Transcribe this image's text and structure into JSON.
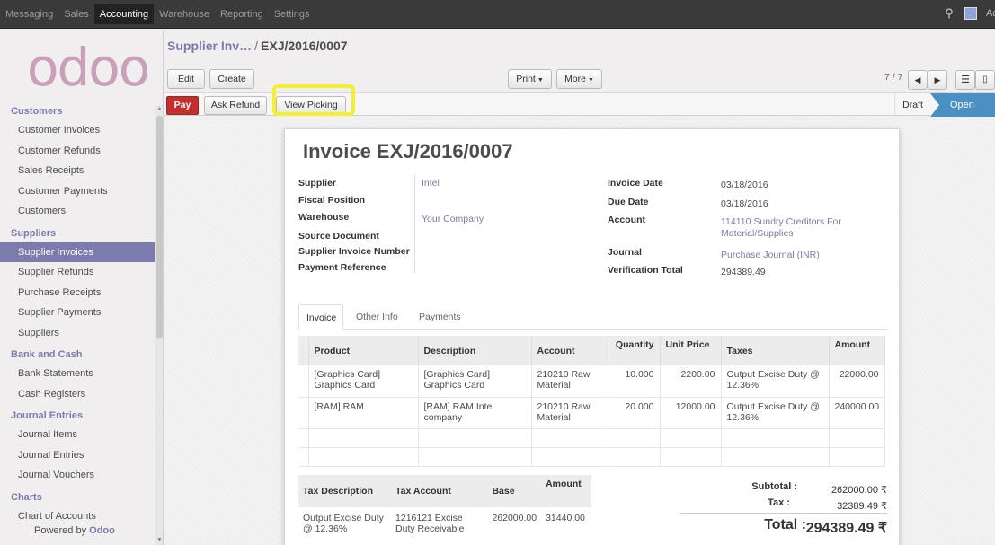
{
  "topbar": {
    "menu": [
      "Messaging",
      "Sales",
      "Accounting",
      "Warehouse",
      "Reporting",
      "Settings"
    ],
    "active": "Accounting",
    "user_text": "Ad"
  },
  "sidebar": {
    "logo": "odoo",
    "sections": [
      {
        "title": "Customers",
        "items": [
          "Customer Invoices",
          "Customer Refunds",
          "Sales Receipts",
          "Customer Payments",
          "Customers"
        ]
      },
      {
        "title": "Suppliers",
        "items": [
          "Supplier Invoices",
          "Supplier Refunds",
          "Purchase Receipts",
          "Supplier Payments",
          "Suppliers"
        ]
      },
      {
        "title": "Bank and Cash",
        "items": [
          "Bank Statements",
          "Cash Registers"
        ]
      },
      {
        "title": "Journal Entries",
        "items": [
          "Journal Items",
          "Journal Entries",
          "Journal Vouchers"
        ]
      },
      {
        "title": "Charts",
        "items": [
          "Chart of Accounts"
        ]
      }
    ],
    "active_item": "Supplier Invoices",
    "powered_prefix": "Powered by",
    "powered_brand": "Odoo"
  },
  "breadcrumb": {
    "parent": "Supplier Inv…",
    "separator": "/",
    "current": "EXJ/2016/0007"
  },
  "toolbar": {
    "edit": "Edit",
    "create": "Create",
    "print": "Print",
    "more": "More",
    "pager": "7 / 7"
  },
  "statusbar": {
    "pay": "Pay",
    "ask_refund": "Ask Refund",
    "view_picking": "View Picking",
    "states": [
      "Draft",
      "Open"
    ],
    "current_state": "Open"
  },
  "invoice": {
    "title": "Invoice EXJ/2016/0007",
    "left_fields": [
      {
        "label": "Supplier",
        "value": "Intel"
      },
      {
        "label": "Fiscal Position",
        "value": ""
      },
      {
        "label": "Warehouse",
        "value": "Your Company"
      },
      {
        "label": "Source Document",
        "value": ""
      },
      {
        "label": "Supplier Invoice Number",
        "value": ""
      },
      {
        "label": "Payment Reference",
        "value": ""
      }
    ],
    "right_fields": [
      {
        "label": "Invoice Date",
        "value": "03/18/2016"
      },
      {
        "label": "Due Date",
        "value": "03/18/2016"
      },
      {
        "label": "Account",
        "value": "114110 Sundry Creditors For Material/Supplies"
      },
      {
        "label": "Journal",
        "value": "Purchase Journal (INR)"
      },
      {
        "label": "Verification Total",
        "value": "294389.49"
      }
    ],
    "tabs": [
      "Invoice",
      "Other Info",
      "Payments"
    ],
    "active_tab": "Invoice",
    "line_headers": [
      "Product",
      "Description",
      "Account",
      "Quantity",
      "Unit Price",
      "Taxes",
      "Amount"
    ],
    "lines": [
      {
        "product": "[Graphics Card] Graphics Card",
        "description": "[Graphics Card] Graphics Card",
        "account": "210210 Raw Material",
        "quantity": "10.000",
        "unit_price": "2200.00",
        "taxes": "Output Excise Duty @ 12.36%",
        "amount": "22000.00"
      },
      {
        "product": "[RAM] RAM",
        "description": "[RAM] RAM Intel company",
        "account": "210210 Raw Material",
        "quantity": "20.000",
        "unit_price": "12000.00",
        "taxes": "Output Excise Duty @ 12.36%",
        "amount": "240000.00"
      }
    ],
    "tax_headers": [
      "Tax Description",
      "Tax Account",
      "Base",
      "Amount"
    ],
    "tax_lines": [
      {
        "description": "Output Excise Duty @ 12.36%",
        "account": "1216121 Excise Duty Receivable",
        "base": "262000.00",
        "amount": "31440.00"
      }
    ],
    "totals": {
      "subtotal_label": "Subtotal :",
      "subtotal": "262000.00 ₹",
      "tax_label": "Tax :",
      "tax": "32389.49 ₹",
      "total_label": "Total :",
      "total": "294389.49 ₹"
    }
  },
  "colors": {
    "brand": "#7c7bad",
    "pay": "#c32e2e",
    "open_state": "#4a90c2",
    "highlight": "#f4f02a"
  }
}
